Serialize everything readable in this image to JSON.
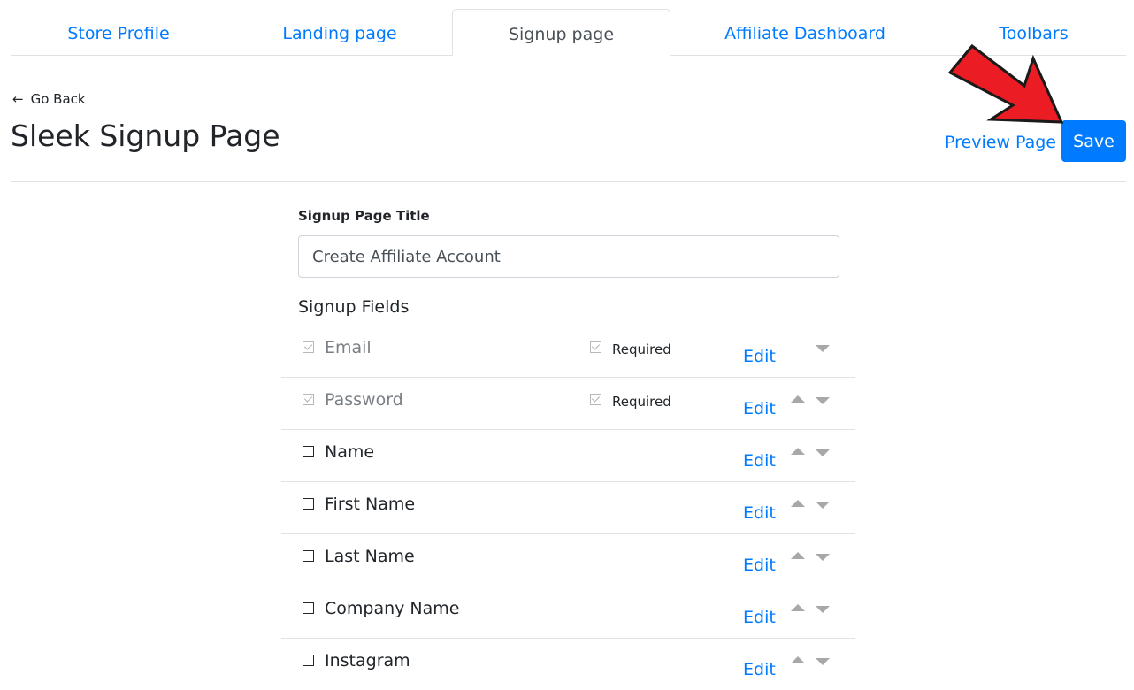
{
  "tabs": [
    {
      "label": "Store Profile",
      "active": false
    },
    {
      "label": "Landing page",
      "active": false
    },
    {
      "label": "Signup page",
      "active": true
    },
    {
      "label": "Affiliate Dashboard",
      "active": false
    },
    {
      "label": "Toolbars",
      "active": false
    }
  ],
  "header": {
    "go_back_icon": "arrow-left-icon",
    "go_back_label": "Go Back",
    "title": "Sleek Signup Page",
    "preview_label": "Preview Page",
    "save_label": "Save"
  },
  "form": {
    "title_label": "Signup Page Title",
    "title_value": "Create Affiliate Account",
    "fields_label": "Signup Fields",
    "edit_label": "Edit",
    "required_label": "Required",
    "fields": [
      {
        "name": "Email",
        "checked": true,
        "locked": true,
        "required": true
      },
      {
        "name": "Password",
        "checked": true,
        "locked": true,
        "required": true
      },
      {
        "name": "Name",
        "checked": false,
        "locked": false,
        "required": false
      },
      {
        "name": "First Name",
        "checked": false,
        "locked": false,
        "required": false
      },
      {
        "name": "Last Name",
        "checked": false,
        "locked": false,
        "required": false
      },
      {
        "name": "Company Name",
        "checked": false,
        "locked": false,
        "required": false
      },
      {
        "name": "Instagram",
        "checked": false,
        "locked": false,
        "required": false
      }
    ]
  },
  "colors": {
    "accent": "#007bff",
    "annotation_arrow": "#ec1c24"
  }
}
